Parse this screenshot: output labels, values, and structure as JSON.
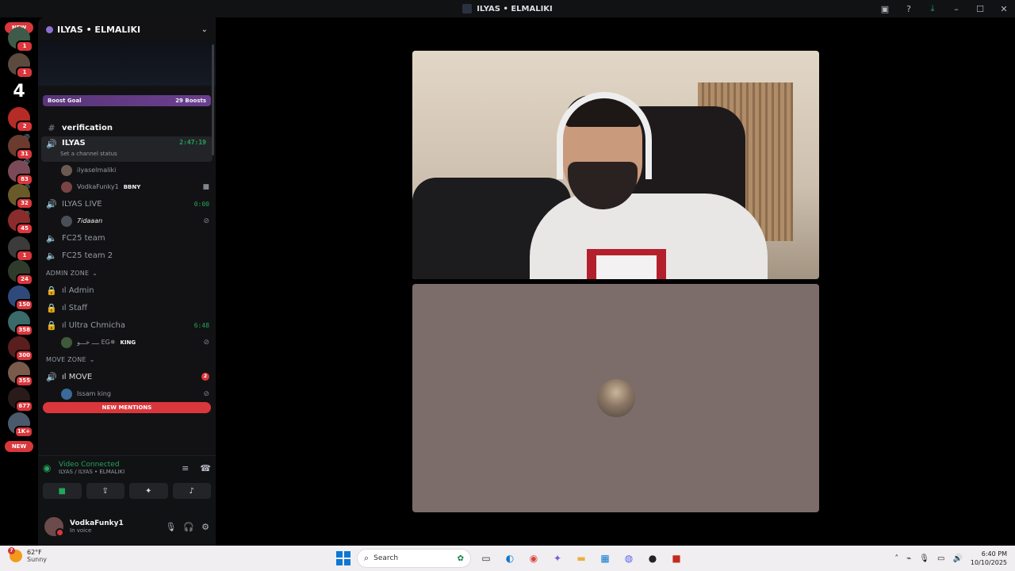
{
  "window": {
    "title": "ILYAS • ELMALIKI"
  },
  "guilds": {
    "new_top": "NEW",
    "new_bottom": "NEW",
    "badges": [
      "1",
      "1",
      "2",
      "31",
      "83",
      "32",
      "45",
      "1",
      "24",
      "150",
      "358",
      "300",
      "355",
      "677",
      "1K+"
    ],
    "four": "4"
  },
  "server": {
    "name": "ILYAS • ELMALIKI",
    "boost_label": "Boost Goal",
    "boost_count": "29 Boosts"
  },
  "channels": {
    "verification": "verification",
    "ilyas": {
      "name": "ILYAS",
      "timer": "2:47:19",
      "status": "Set a channel status"
    },
    "ilyas_users": [
      {
        "name": "ilyaselmaliki",
        "tag": ""
      },
      {
        "name": "VodkaFunky1",
        "tag": "BBNY"
      }
    ],
    "ilyas_live": {
      "name": "ILYAS LIVE",
      "timer": "0:00"
    },
    "live_users": [
      {
        "name": "7idaaan"
      }
    ],
    "fc25_team": "FC25 team",
    "fc25_team2": "FC25 team 2",
    "admin_zone": "ADMIN ZONE",
    "admin": "ıl Admin",
    "staff": "ıl Staff",
    "ultra": {
      "name": "ıl Ultra Chmicha",
      "timer": "6:48"
    },
    "ultra_users": [
      {
        "name": "ــــ خـــو EG✵",
        "tag": "KING"
      }
    ],
    "move_zone": "MOVE ZONE",
    "move": {
      "name": "ıl MOVE",
      "count": "2"
    },
    "move_users": [
      {
        "name": "Issam king"
      }
    ],
    "new_mentions": "NEW MENTIONS"
  },
  "voice": {
    "status": "Video Connected",
    "location": "ILYAS / ILYAS • ELMALIKI"
  },
  "user": {
    "name": "VodkaFunky1",
    "status": "In voice"
  },
  "taskbar": {
    "temp": "62°F",
    "weather": "Sunny",
    "weather_badge": "7",
    "search_placeholder": "Search",
    "time": "6:40 PM",
    "date": "10/10/2025"
  }
}
